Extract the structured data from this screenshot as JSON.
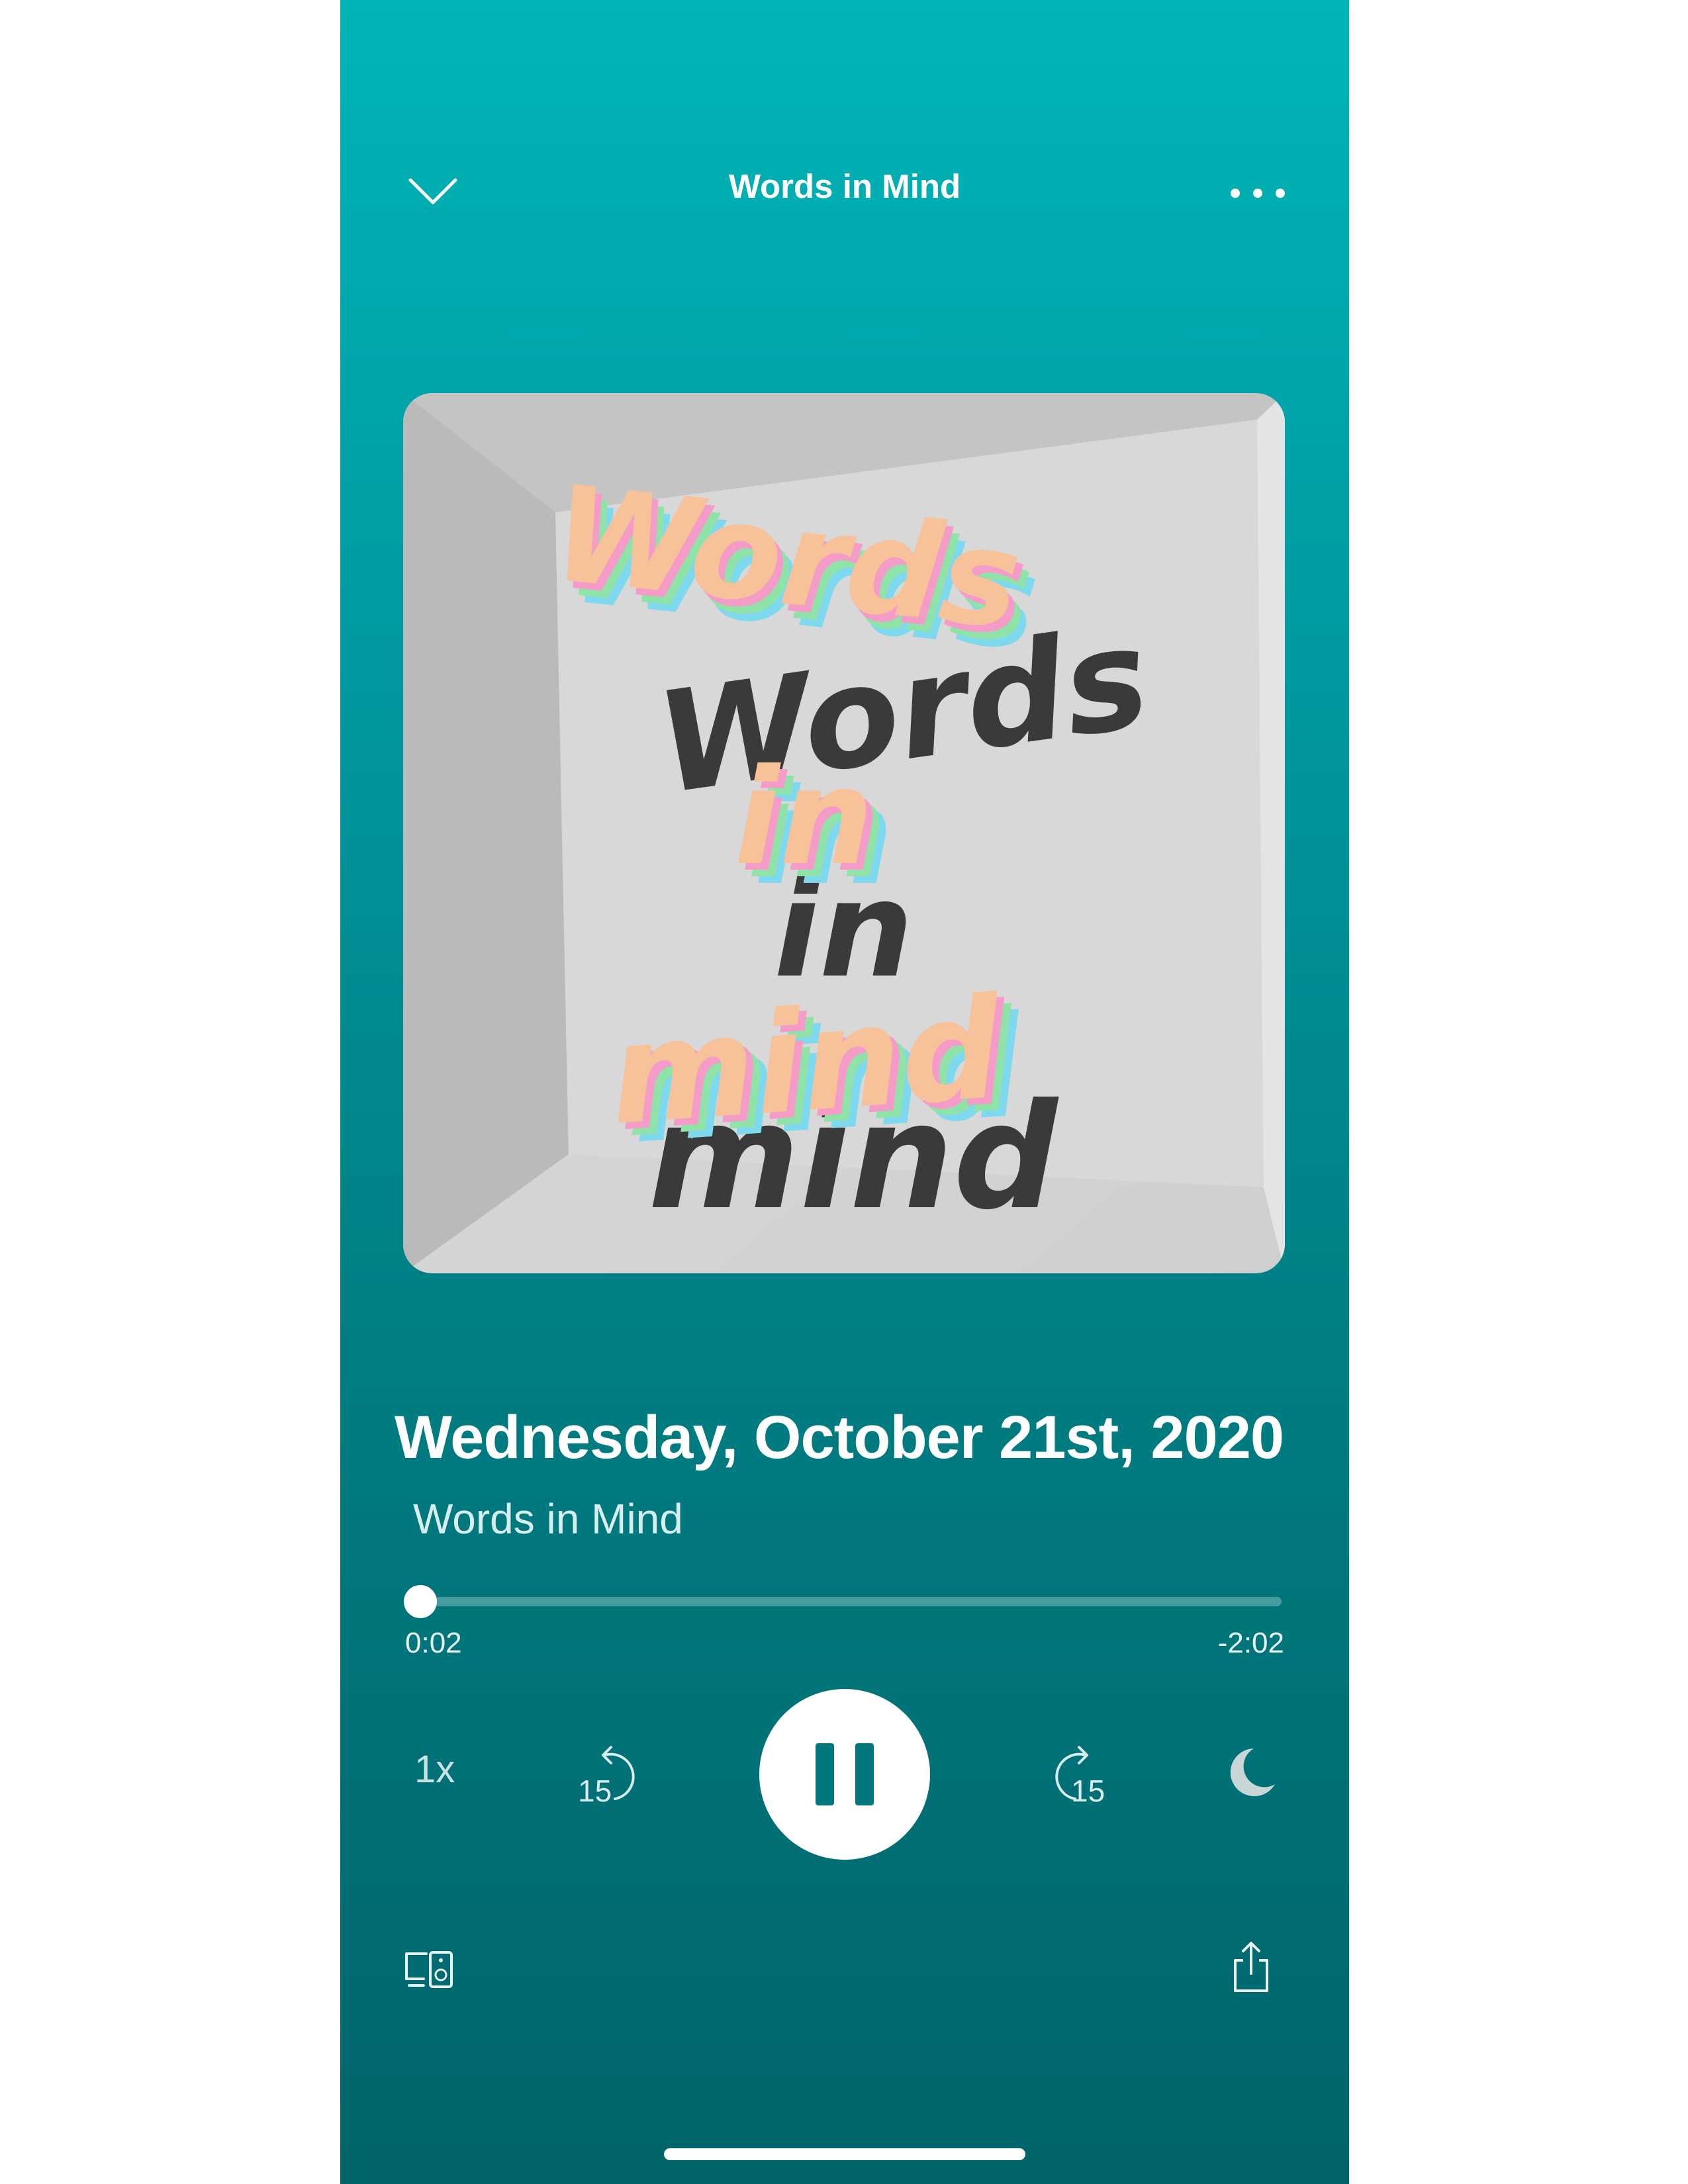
{
  "header": {
    "title": "Words in Mind"
  },
  "artwork": {
    "lines": [
      "Words",
      "in",
      "mind"
    ]
  },
  "episode": {
    "title": "Wednesday, October 21st, 2020",
    "show": "Words in Mind"
  },
  "progress": {
    "fraction": 0.016,
    "elapsed": "0:02",
    "remaining": "-2:02"
  },
  "controls": {
    "speed": "1x",
    "rewind_seconds": "15",
    "forward_seconds": "15",
    "state": "playing"
  },
  "icons": {
    "collapse": "chevron-down-icon",
    "more": "more-icon",
    "rewind": "rewind-15-icon",
    "forward": "forward-15-icon",
    "pause": "pause-icon",
    "sleep": "moon-icon",
    "devices": "devices-icon",
    "share": "share-icon"
  },
  "colors": {
    "background_top": "#00b5b8",
    "background_bottom": "#00646a",
    "accent": "#ffffff",
    "artwork_text": "#f7c19a"
  }
}
